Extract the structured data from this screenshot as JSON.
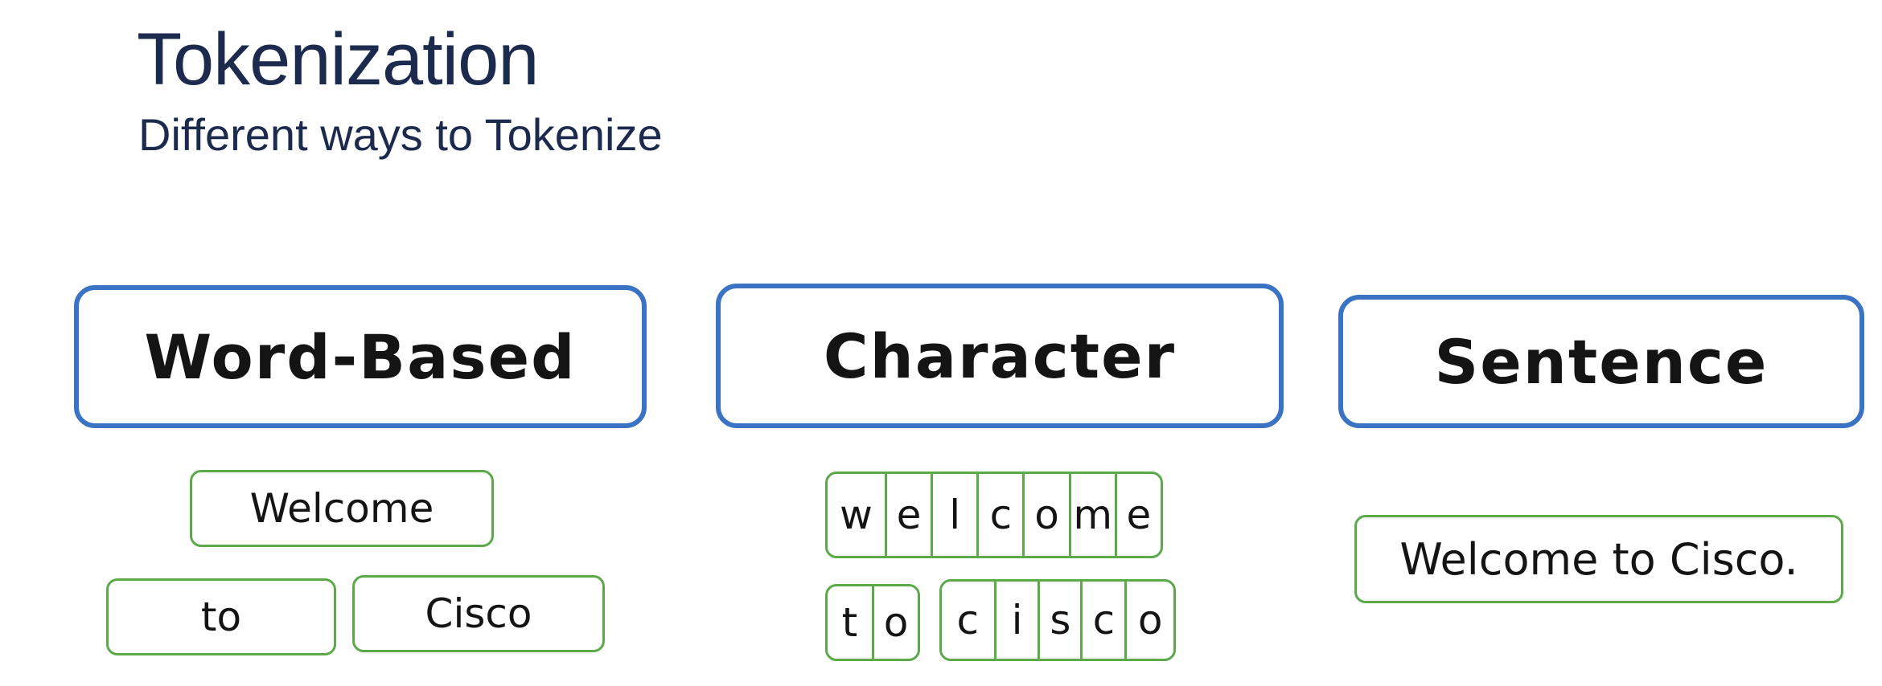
{
  "header": {
    "title": "Tokenization",
    "subtitle": "Different ways to Tokenize"
  },
  "columns": [
    {
      "label": "Word-Based",
      "tokens": [
        "Welcome",
        "to",
        "Cisco"
      ]
    },
    {
      "label": "Character",
      "groups": [
        [
          "w",
          "e",
          "l",
          "c",
          "o",
          "m",
          "e"
        ],
        [
          "t",
          "o"
        ],
        [
          "c",
          "i",
          "s",
          "c",
          "o"
        ]
      ]
    },
    {
      "label": "Sentence",
      "tokens": [
        "Welcome to Cisco."
      ]
    }
  ],
  "colors": {
    "title": "#1b2a4d",
    "category_border": "#3b73c4",
    "token_border": "#5ca94a"
  }
}
